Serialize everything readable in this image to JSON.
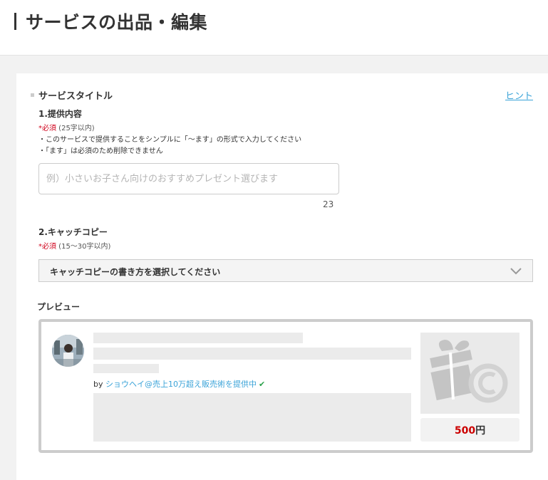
{
  "header": {
    "title": "サービスの出品・編集"
  },
  "section": {
    "title": "サービスタイトル",
    "hint_link": "ヒント"
  },
  "field1": {
    "label": "1.提供内容",
    "required_mark": "*必須",
    "required_detail": " (25字以内)",
    "note1": "・このサービスで提供することをシンプルに「〜ます」の形式で入力してください",
    "note2": "・「ます」は必須のため削除できません",
    "placeholder": "例）小さいお子さん向けのおすすめプレゼント選びます",
    "value": "",
    "counter": "23"
  },
  "field2": {
    "label": "2.キャッチコピー",
    "required_mark": "*必須",
    "required_detail": " (15〜30字以内)",
    "select_text": "キャッチコピーの書き方を選択してください"
  },
  "preview": {
    "label": "プレビュー",
    "by": "by",
    "seller_name": "ショウヘイ@売上10万超え販売術を提供中",
    "verified_icon": "check-icon",
    "price_value": "500",
    "price_unit": "円"
  },
  "colors": {
    "link": "#3aa3d8",
    "required": "#d0021b",
    "price": "#cc0000",
    "verified": "#2ca24c"
  }
}
